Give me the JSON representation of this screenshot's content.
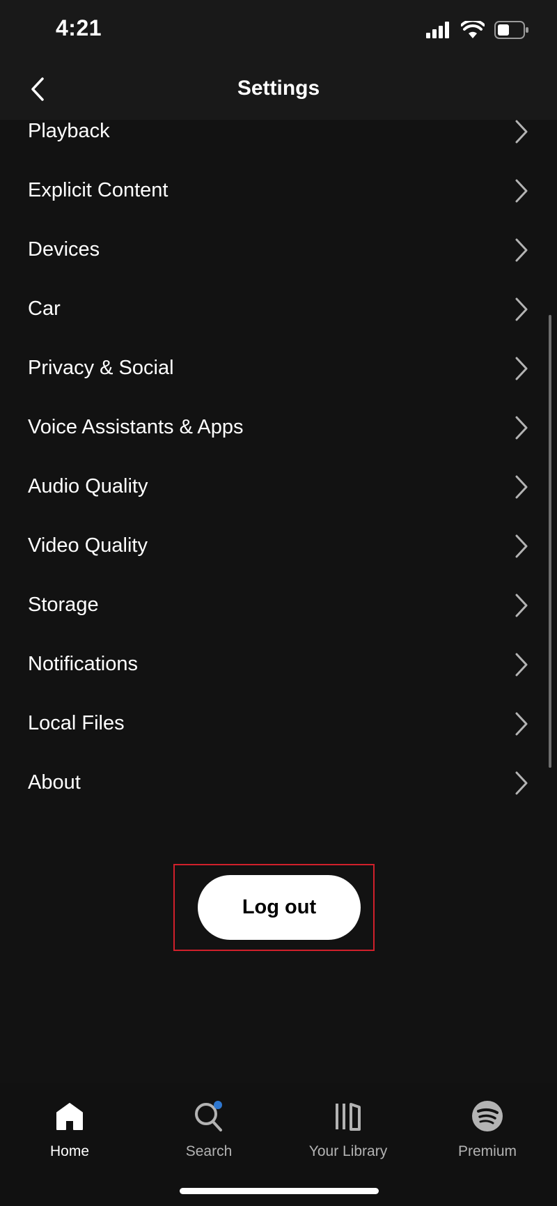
{
  "status_bar": {
    "time": "4:21",
    "icons": [
      "signal-icon",
      "wifi-icon",
      "battery-icon"
    ]
  },
  "header": {
    "title": "Settings",
    "back_icon": "chevron-left-icon"
  },
  "settings": {
    "items": [
      {
        "label": "Playback"
      },
      {
        "label": "Explicit Content"
      },
      {
        "label": "Devices"
      },
      {
        "label": "Car"
      },
      {
        "label": "Privacy & Social"
      },
      {
        "label": "Voice Assistants & Apps"
      },
      {
        "label": "Audio Quality"
      },
      {
        "label": "Video Quality"
      },
      {
        "label": "Storage"
      },
      {
        "label": "Notifications"
      },
      {
        "label": "Local Files"
      },
      {
        "label": "About"
      }
    ]
  },
  "logout": {
    "label": "Log out",
    "highlight_color": "#d0202b"
  },
  "bottom_nav": {
    "items": [
      {
        "label": "Home",
        "icon": "home-icon",
        "active": true
      },
      {
        "label": "Search",
        "icon": "search-icon",
        "active": false,
        "badge_color": "#2e77d0"
      },
      {
        "label": "Your Library",
        "icon": "library-icon",
        "active": false
      },
      {
        "label": "Premium",
        "icon": "spotify-icon",
        "active": false
      }
    ]
  },
  "colors": {
    "background": "#121212",
    "header": "#191919",
    "text": "#ffffff",
    "muted_text": "#b3b3b3"
  }
}
